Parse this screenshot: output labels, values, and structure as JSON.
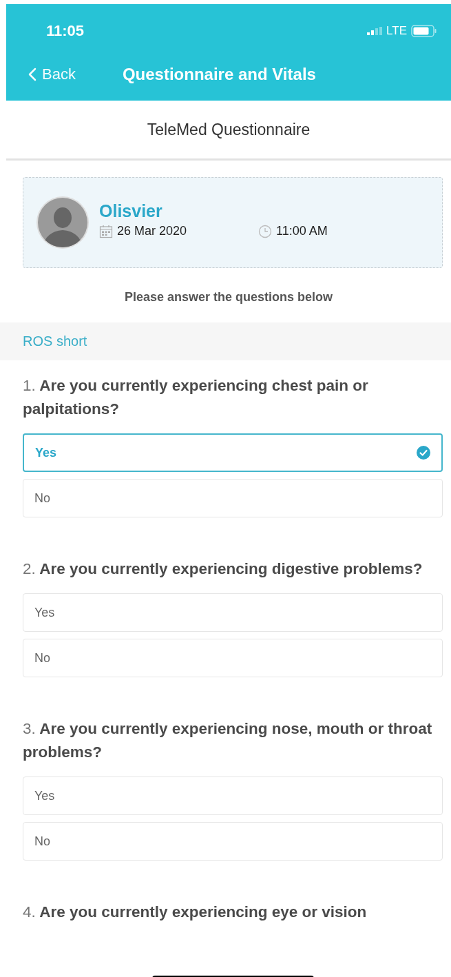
{
  "status_bar": {
    "time": "11:05",
    "network": "LTE"
  },
  "nav": {
    "back": "Back",
    "title": "Questionnaire and Vitals"
  },
  "page_title": "TeleMed Questionnaire",
  "appointment": {
    "name": "Olisvier",
    "date": "26 Mar 2020",
    "time": "11:00 AM"
  },
  "instruction": "Please answer the questions below",
  "section": "ROS short",
  "questions": [
    {
      "number": "1.",
      "text": "Are you currently experiencing chest pain or palpitations?",
      "options": [
        {
          "label": "Yes",
          "selected": true
        },
        {
          "label": "No",
          "selected": false
        }
      ]
    },
    {
      "number": "2.",
      "text": "Are you currently experiencing digestive problems?",
      "options": [
        {
          "label": "Yes",
          "selected": false
        },
        {
          "label": "No",
          "selected": false
        }
      ]
    },
    {
      "number": "3.",
      "text": "Are you currently experiencing nose, mouth or throat problems?",
      "options": [
        {
          "label": "Yes",
          "selected": false
        },
        {
          "label": "No",
          "selected": false
        }
      ]
    },
    {
      "number": "4.",
      "text": "Are you currently experiencing eye or vision"
    }
  ]
}
